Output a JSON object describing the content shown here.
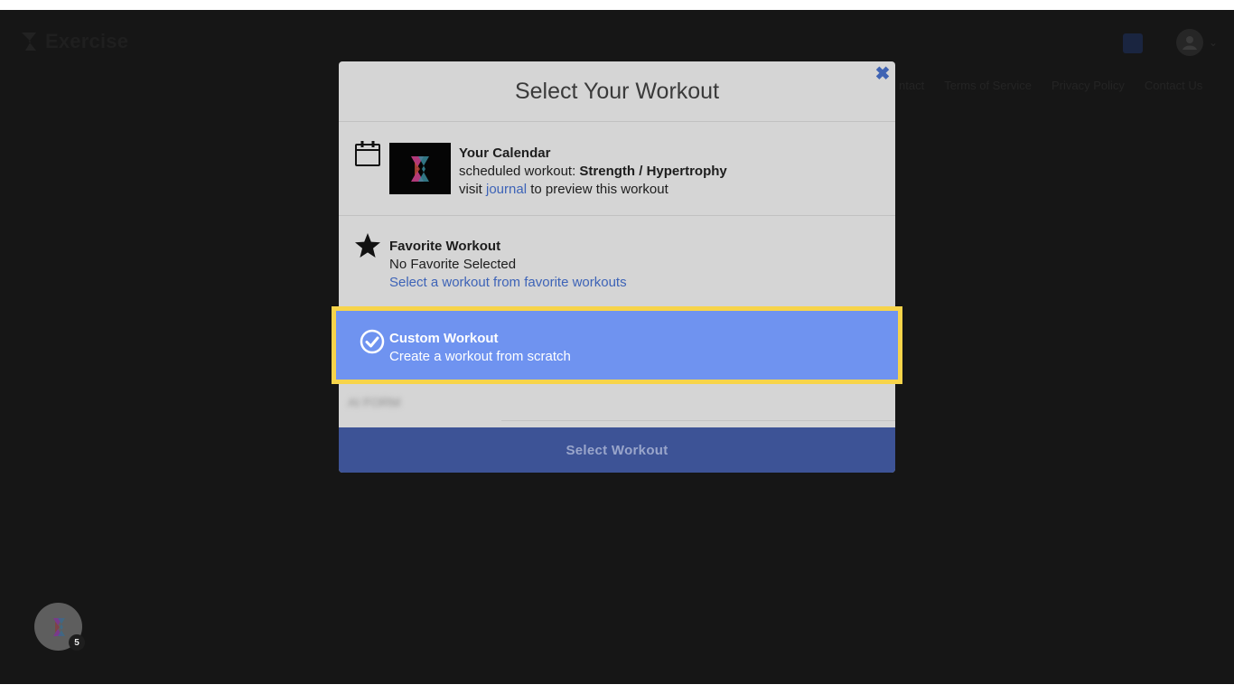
{
  "app": {
    "name": "Exercise"
  },
  "nav": {
    "links": [
      "ntact",
      "Terms of Service",
      "Privacy Policy",
      "Contact Us"
    ]
  },
  "modal": {
    "title": "Select Your Workout",
    "close_icon": "close-icon",
    "calendar": {
      "heading": "Your Calendar",
      "scheduled_prefix": "scheduled workout: ",
      "scheduled_workout": "Strength / Hypertrophy",
      "visit_prefix": "visit ",
      "journal_link": "journal",
      "visit_suffix": " to preview this workout"
    },
    "favorite": {
      "heading": "Favorite Workout",
      "status": "No Favorite Selected",
      "link": "Select a workout from favorite workouts"
    },
    "custom": {
      "heading": "Custom Workout",
      "subtitle": "Create a workout from scratch",
      "selected": true
    },
    "blurred_text": "AI FORM",
    "select_button": "Select Workout"
  },
  "fab": {
    "badge": "5"
  },
  "colors": {
    "accent": "#3d63b7",
    "highlight_border": "#f7d44a",
    "selected_row": "#6f93f0",
    "button": "#3d5396"
  }
}
